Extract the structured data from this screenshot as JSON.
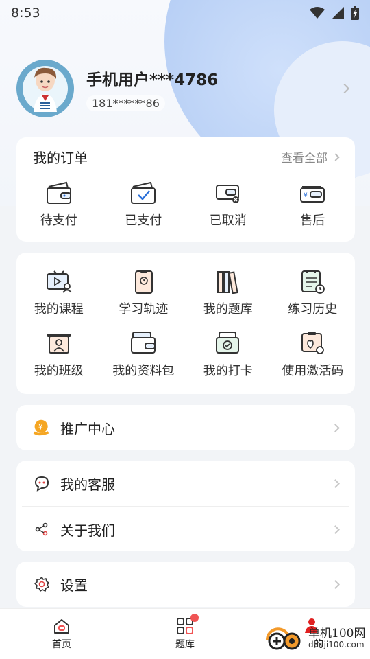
{
  "status_bar": {
    "time": "8:53"
  },
  "profile": {
    "username": "手机用户***4786",
    "phone": "181******86"
  },
  "orders": {
    "title": "我的订单",
    "view_all": "查看全部",
    "items": [
      {
        "label": "待支付",
        "icon": "wallet-pending-icon"
      },
      {
        "label": "已支付",
        "icon": "wallet-paid-icon"
      },
      {
        "label": "已取消",
        "icon": "wallet-cancelled-icon"
      },
      {
        "label": "售后",
        "icon": "after-sales-icon"
      }
    ]
  },
  "tools": {
    "items": [
      {
        "label": "我的课程",
        "icon": "course-video-icon"
      },
      {
        "label": "学习轨迹",
        "icon": "learning-track-icon"
      },
      {
        "label": "我的题库",
        "icon": "question-bank-icon"
      },
      {
        "label": "练习历史",
        "icon": "practice-history-icon"
      },
      {
        "label": "我的班级",
        "icon": "class-icon"
      },
      {
        "label": "我的资料包",
        "icon": "materials-package-icon"
      },
      {
        "label": "我的打卡",
        "icon": "check-in-icon"
      },
      {
        "label": "使用激活码",
        "icon": "activation-code-icon"
      }
    ]
  },
  "promo": {
    "label": "推广中心"
  },
  "service": {
    "customer_service": "我的客服",
    "about_us": "关于我们"
  },
  "settings": {
    "label": "设置"
  },
  "tabbar": {
    "home": "首页",
    "question_bank": "题库",
    "mine": "的"
  },
  "watermark": {
    "line1": "单机100网",
    "line2": "danji100.com"
  }
}
